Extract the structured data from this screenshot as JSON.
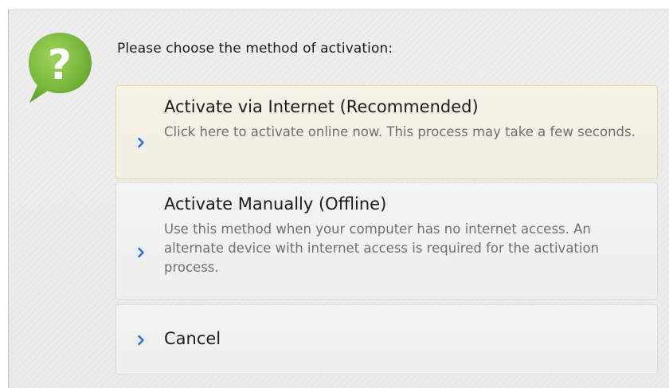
{
  "dialog": {
    "instruction": "Please choose the method of activation:",
    "help_icon": "question-speech-bubble-icon",
    "accent_color": "#7cba3f",
    "options": [
      {
        "id": "internet",
        "title": "Activate via Internet (Recommended)",
        "description": "Click here to activate online now. This process may take a few seconds.",
        "icon": "chevron-right-icon",
        "highlighted": true
      },
      {
        "id": "manual",
        "title": "Activate Manually (Offline)",
        "description": "Use this method when your computer has no internet access. An alternate device with internet access is required for the activation process.",
        "icon": "chevron-right-icon",
        "highlighted": false
      },
      {
        "id": "cancel",
        "title": "Cancel",
        "icon": "chevron-right-icon",
        "highlighted": false
      }
    ]
  }
}
